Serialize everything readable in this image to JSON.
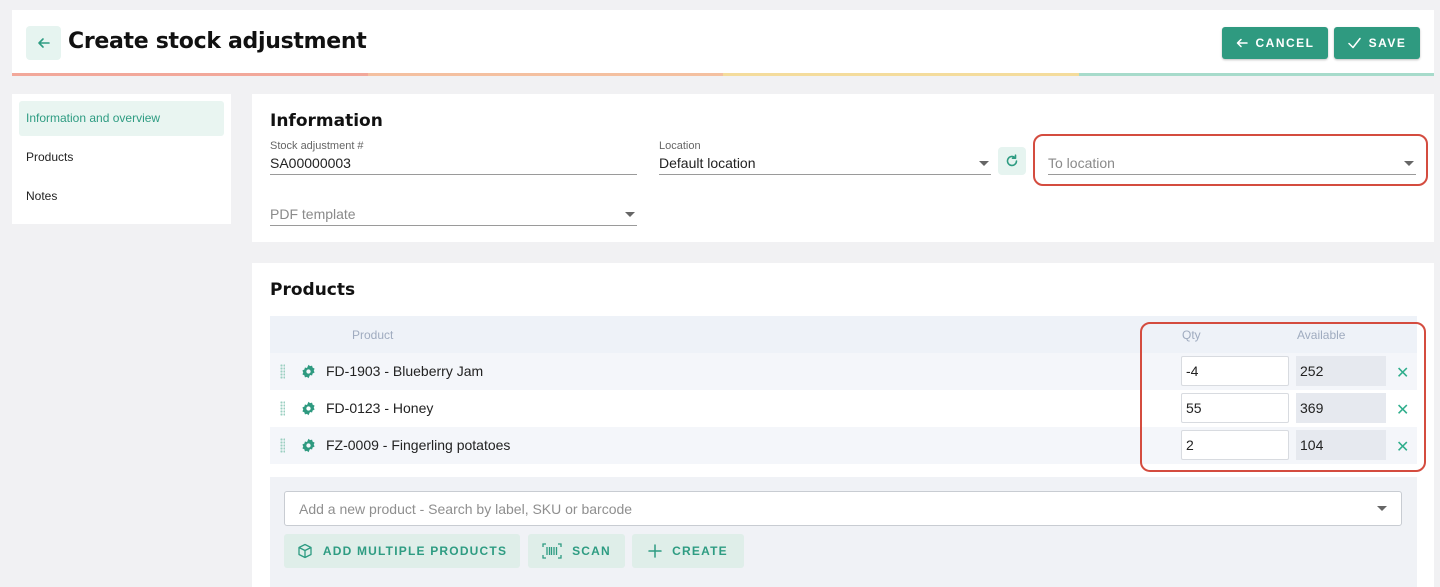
{
  "header": {
    "title": "Create stock adjustment",
    "cancel_label": "CANCEL",
    "save_label": "SAVE",
    "stripe_colors": [
      "#f2a89a",
      "#f4c0a0",
      "#f4dc9c",
      "#a7dbcb"
    ]
  },
  "sidebar": {
    "items": [
      {
        "label": "Information and overview",
        "active": true
      },
      {
        "label": "Products",
        "active": false
      },
      {
        "label": "Notes",
        "active": false
      }
    ]
  },
  "information": {
    "title": "Information",
    "stock_adjustment_label": "Stock adjustment #",
    "stock_adjustment_value": "SA00000003",
    "location_label": "Location",
    "location_value": "Default location",
    "to_location_placeholder": "To location",
    "pdf_template_placeholder": "PDF template"
  },
  "products": {
    "title": "Products",
    "columns": {
      "product": "Product",
      "qty": "Qty",
      "available": "Available"
    },
    "rows": [
      {
        "name": "FD-1903 - Blueberry Jam",
        "qty": "-4",
        "available": "252"
      },
      {
        "name": "FD-0123 - Honey",
        "qty": "55",
        "available": "369"
      },
      {
        "name": "FZ-0009 - Fingerling potatoes",
        "qty": "2",
        "available": "104"
      }
    ],
    "search_placeholder": "Add a new product - Search by label, SKU or barcode",
    "add_multiple_label": "ADD MULTIPLE PRODUCTS",
    "scan_label": "SCAN",
    "create_label": "CREATE"
  },
  "colors": {
    "accent": "#2f9a80",
    "highlight": "#d44c3f"
  }
}
